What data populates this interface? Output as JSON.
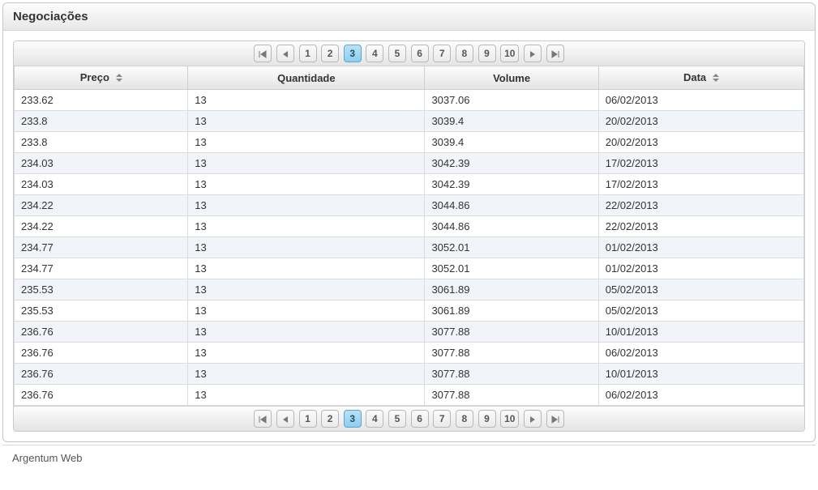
{
  "panel": {
    "title": "Negociações"
  },
  "table": {
    "columns": {
      "preco": "Preço",
      "quantidade": "Quantidade",
      "volume": "Volume",
      "data": "Data"
    },
    "rows": [
      {
        "preco": "233.62",
        "quantidade": "13",
        "volume": "3037.06",
        "data": "06/02/2013"
      },
      {
        "preco": "233.8",
        "quantidade": "13",
        "volume": "3039.4",
        "data": "20/02/2013"
      },
      {
        "preco": "233.8",
        "quantidade": "13",
        "volume": "3039.4",
        "data": "20/02/2013"
      },
      {
        "preco": "234.03",
        "quantidade": "13",
        "volume": "3042.39",
        "data": "17/02/2013"
      },
      {
        "preco": "234.03",
        "quantidade": "13",
        "volume": "3042.39",
        "data": "17/02/2013"
      },
      {
        "preco": "234.22",
        "quantidade": "13",
        "volume": "3044.86",
        "data": "22/02/2013"
      },
      {
        "preco": "234.22",
        "quantidade": "13",
        "volume": "3044.86",
        "data": "22/02/2013"
      },
      {
        "preco": "234.77",
        "quantidade": "13",
        "volume": "3052.01",
        "data": "01/02/2013"
      },
      {
        "preco": "234.77",
        "quantidade": "13",
        "volume": "3052.01",
        "data": "01/02/2013"
      },
      {
        "preco": "235.53",
        "quantidade": "13",
        "volume": "3061.89",
        "data": "05/02/2013"
      },
      {
        "preco": "235.53",
        "quantidade": "13",
        "volume": "3061.89",
        "data": "05/02/2013"
      },
      {
        "preco": "236.76",
        "quantidade": "13",
        "volume": "3077.88",
        "data": "10/01/2013"
      },
      {
        "preco": "236.76",
        "quantidade": "13",
        "volume": "3077.88",
        "data": "06/02/2013"
      },
      {
        "preco": "236.76",
        "quantidade": "13",
        "volume": "3077.88",
        "data": "10/01/2013"
      },
      {
        "preco": "236.76",
        "quantidade": "13",
        "volume": "3077.88",
        "data": "06/02/2013"
      }
    ]
  },
  "paginator": {
    "pages": [
      "1",
      "2",
      "3",
      "4",
      "5",
      "6",
      "7",
      "8",
      "9",
      "10"
    ],
    "current": "3"
  },
  "footer": {
    "text": "Argentum Web"
  }
}
